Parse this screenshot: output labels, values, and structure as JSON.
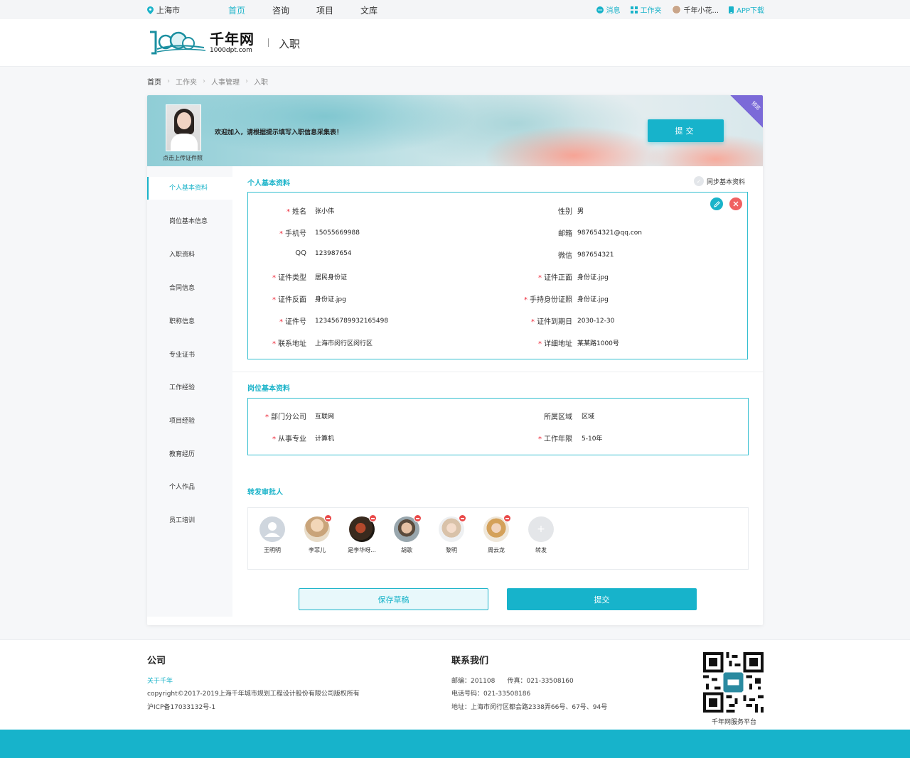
{
  "topbar": {
    "location": "上海市",
    "nav": [
      "首页",
      "咨询",
      "项目",
      "文库"
    ],
    "messages": "消息",
    "workspace": "工作夹",
    "user": "千年小花...",
    "app": "APP下载"
  },
  "header": {
    "logo_cn": "千年网",
    "logo_en": "1000dpt.com",
    "page_name": "入职"
  },
  "breadcrumb": [
    "首页",
    "工作夹",
    "人事管理",
    "入职"
  ],
  "banner": {
    "photo_label": "点击上传证件照",
    "welcome": "欢迎加入，请根据提示填写入职信息采集表！",
    "submit": "提交",
    "corner": "预览"
  },
  "sidenav": [
    "个人基本资料",
    "岗位基本信息",
    "入职资料",
    "合同信息",
    "职称信息",
    "专业证书",
    "工作经验",
    "项目经验",
    "教育经历",
    "个人作品",
    "员工培训"
  ],
  "personal": {
    "title": "个人基本资料",
    "sync": "同步基本资料",
    "left": [
      {
        "label": "姓名",
        "required": "*",
        "value": "张小伟"
      },
      {
        "label": "手机号",
        "required": "*",
        "value": "15055669988"
      },
      {
        "label": "QQ",
        "required": "",
        "value": "123987654"
      },
      {
        "label": "证件类型",
        "required": "*",
        "value": "居民身份证"
      },
      {
        "label": "证件反面",
        "required": "*",
        "value": "身份证.jpg"
      },
      {
        "label": "证件号",
        "required": "*",
        "value": "123456789932165498"
      },
      {
        "label": "联系地址",
        "required": "*",
        "value": "上海市闵行区闵行区"
      }
    ],
    "right": [
      {
        "label": "性别",
        "required": "",
        "value": "男"
      },
      {
        "label": "邮箱",
        "required": "",
        "value": "987654321@qq.con"
      },
      {
        "label": "微信",
        "required": "",
        "value": "987654321"
      },
      {
        "label": "证件正面",
        "required": "*",
        "value": "身份证.jpg"
      },
      {
        "label": "手持身份证照",
        "required": "*",
        "value": "身份证.jpg"
      },
      {
        "label": "证件到期日",
        "required": "*",
        "value": "2030-12-30"
      },
      {
        "label": "详细地址",
        "required": "*",
        "value": "某某路1000号"
      }
    ]
  },
  "position": {
    "title": "岗位基本资料",
    "left": [
      {
        "label": "部门分公司",
        "required": "*",
        "value": "互联网"
      },
      {
        "label": "从事专业",
        "required": "*",
        "value": "计算机"
      }
    ],
    "right": [
      {
        "label": "所属区域",
        "required": "",
        "value": "区域"
      },
      {
        "label": "工作年限",
        "required": "*",
        "value": "5-10年"
      }
    ]
  },
  "approvers": {
    "title": "转发审批人",
    "people": [
      "王明明",
      "李菲儿",
      "是李华呀...",
      "胡歌",
      "黎明",
      "周云龙"
    ],
    "add_label": "转发",
    "add_symbol": "+"
  },
  "actions": {
    "draft": "保存草稿",
    "submit": "提交"
  },
  "footer": {
    "company_title": "公司",
    "about": "关于千年",
    "copyright": "copyright©2017-2019上海千年城市规划工程设计股份有限公司版权所有",
    "icp": "沪ICP备17033132号-1",
    "contact_title": "联系我们",
    "postal_fax": "邮编：201108      传真：021-33508160",
    "phone": "电话号码：021-33508186",
    "address": "地址：上海市闵行区都会路2338弄66号、67号、94号",
    "qr_label": "千年网服务平台"
  },
  "colors": {
    "accent": "#1ab3c9",
    "danger": "#f06161",
    "required": "#e22233",
    "corner": "#7b6ad8"
  }
}
